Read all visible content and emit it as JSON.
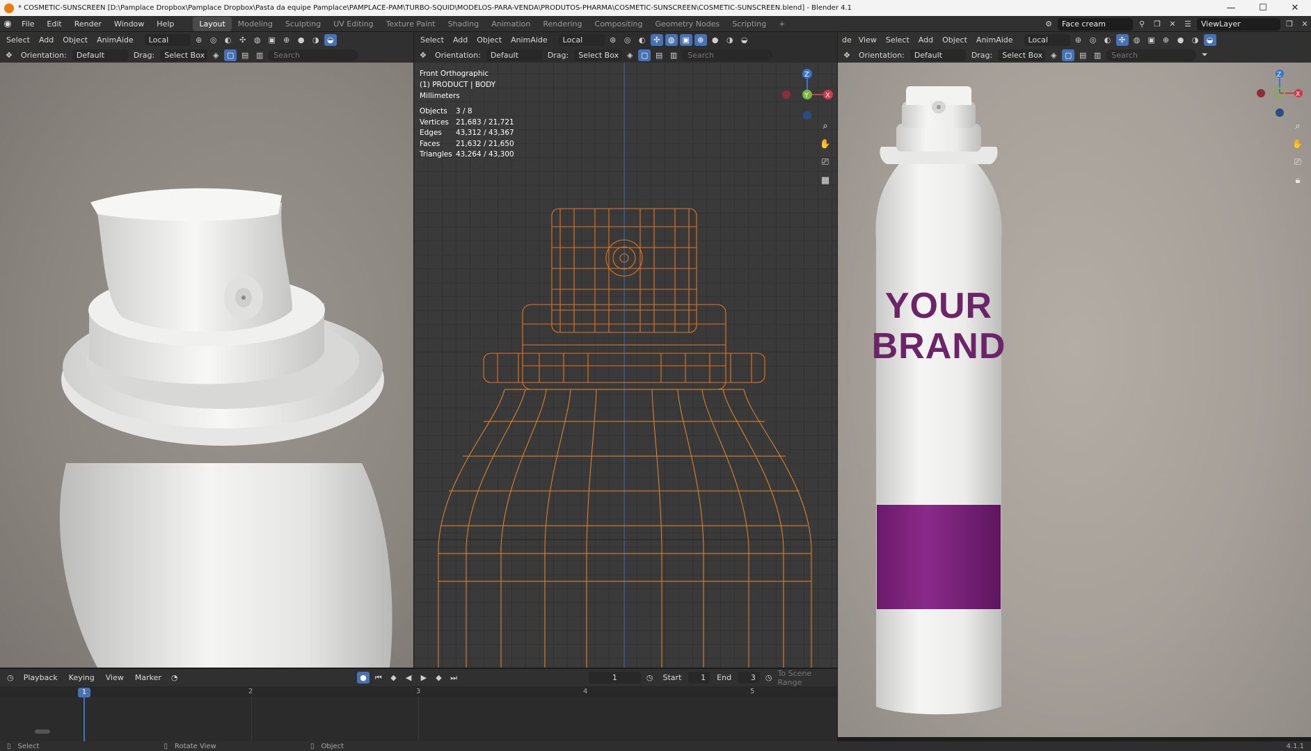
{
  "title_bar": {
    "title": "* COSMETIC-SUNSCREEN [D:\\Pamplace Dropbox\\Pamplace Dropbox\\Pasta da equipe Pamplace\\PAMPLACE-PAM\\TURBO-SQUID\\MODELOS-PARA-VENDA\\PRODUTOS-PHARMA\\COSMETIC-SUNSCREEN\\COSMETIC-SUNSCREEN.blend] - Blender 4.1",
    "minimize": "—",
    "maximize": "☐",
    "close": "✕"
  },
  "menu": [
    "File",
    "Edit",
    "Render",
    "Window",
    "Help"
  ],
  "workspaces": [
    "Layout",
    "Modeling",
    "Sculpting",
    "UV Editing",
    "Texture Paint",
    "Shading",
    "Animation",
    "Rendering",
    "Compositing",
    "Geometry Nodes",
    "Scripting",
    "+"
  ],
  "scene": {
    "name": "Face cream",
    "view_layer": "ViewLayer"
  },
  "left_viewport": {
    "header": [
      "Select",
      "Add",
      "Object",
      "AnimAide"
    ],
    "transform": "Local",
    "orientation_label": "Orientation:",
    "orientation": "Default",
    "drag_label": "Drag:",
    "drag": "Select Box",
    "search": "Search"
  },
  "center_viewport": {
    "header": [
      "Select",
      "Add",
      "Object",
      "AnimAide"
    ],
    "transform": "Local",
    "orientation_label": "Orientation:",
    "orientation": "Default",
    "drag_label": "Drag:",
    "drag": "Select Box",
    "search": "Search",
    "overlay": {
      "view": "Front Orthographic",
      "object": "(1) PRODUCT | BODY",
      "units": "Millimeters"
    },
    "stats": [
      {
        "label": "Objects",
        "value": "3 / 8"
      },
      {
        "label": "Vertices",
        "value": "21,683 / 21,721"
      },
      {
        "label": "Edges",
        "value": "43,312 / 43,367"
      },
      {
        "label": "Faces",
        "value": "21,632 / 21,650"
      },
      {
        "label": "Triangles",
        "value": "43,264 / 43,300"
      }
    ],
    "gizmo": {
      "z": "Z",
      "y": "Y",
      "x": "X"
    }
  },
  "right_viewport": {
    "mode_tail": "de",
    "header": [
      "View",
      "Select",
      "Add",
      "Object",
      "AnimAide"
    ],
    "transform": "Local",
    "orientation_label": "Orientation:",
    "orientation": "Default",
    "drag_label": "Drag:",
    "drag": "Select Box",
    "search": "Search",
    "label_line1": "YOUR",
    "label_line2": "BRAND",
    "brand_color": "#6b2468",
    "band_color": "#7a1e7a",
    "gizmo": {
      "z": "Z",
      "x": "X"
    }
  },
  "timeline": {
    "menus": [
      "Playback",
      "Keying",
      "View",
      "Marker"
    ],
    "current_frame": "1",
    "start_label": "Start",
    "start": "1",
    "end_label": "End",
    "end": "3",
    "scene_range": "To Scene Range",
    "frames": [
      "1",
      "2",
      "3",
      "4",
      "5"
    ]
  },
  "status_bar": {
    "select": "Select",
    "rotate": "Rotate View",
    "object": "Object",
    "version": "4.1.1"
  },
  "colors": {
    "wire_orange": "#e8741c",
    "wire_light": "#f0a04a",
    "bg_grid": "#3a3a3a",
    "accent": "#4772b3"
  }
}
